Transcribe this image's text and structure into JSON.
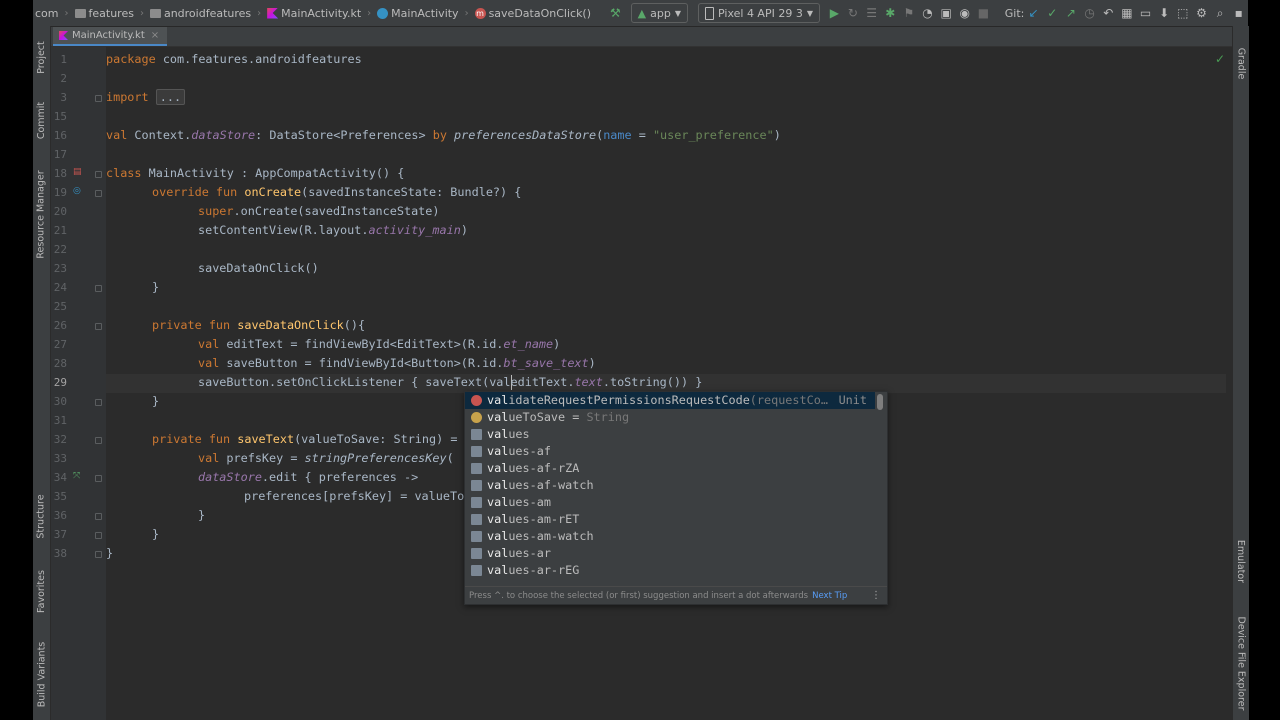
{
  "toolbar": {
    "breadcrumbs": [
      "com",
      "features",
      "androidfeatures",
      "MainActivity.kt",
      "MainActivity",
      "saveDataOnClick()"
    ],
    "run_config": "app",
    "device": "Pixel 4 API 29 3",
    "git_label": "Git:"
  },
  "tab": {
    "label": "MainActivity.kt",
    "close": "×"
  },
  "left_tool_windows": [
    "Project",
    "Commit",
    "Resource Manager",
    "Structure",
    "Favorites",
    "Build Variants"
  ],
  "right_tool_windows": [
    "Gradle",
    "Emulator",
    "Device File Explorer"
  ],
  "line_numbers": [
    "1",
    "2",
    "3",
    "15",
    "16",
    "17",
    "18",
    "19",
    "20",
    "21",
    "22",
    "23",
    "24",
    "25",
    "26",
    "27",
    "28",
    "29",
    "30",
    "31",
    "32",
    "33",
    "34",
    "35",
    "36",
    "37",
    "38"
  ],
  "current_line": "29",
  "code": {
    "l1": {
      "kw": "package",
      "rest": " com.features.androidfeatures"
    },
    "l3": {
      "kw": "import",
      "rest": " ",
      "folded": "..."
    },
    "l16": {
      "kw": "val",
      "a": " Context.",
      "b": "dataStore",
      "c": ": DataStore<Preferences> ",
      "kw2": "by",
      "d": " ",
      "e": "preferencesDataStore",
      "f": "(",
      "g": "name",
      "h": " = ",
      "i": "\"user_preference\"",
      "j": ")"
    },
    "l18": {
      "kw": "class",
      "rest": " MainActivity : AppCompatActivity() {"
    },
    "l19": {
      "kw": "override fun",
      "fn": " onCreate",
      "rest": "(savedInstanceState: Bundle?) {"
    },
    "l20": {
      "kw": "super",
      "rest": ".onCreate(savedInstanceState)"
    },
    "l21": {
      "a": "setContentView(R.layout.",
      "b": "activity_main",
      "c": ")"
    },
    "l23": {
      "a": "saveDataOnClick()"
    },
    "l24": {
      "a": "}"
    },
    "l26": {
      "kw": "private fun",
      "fn": " saveDataOnClick",
      "rest": "(){"
    },
    "l27": {
      "kw": "val",
      "a": " editText = findViewById<EditText>(R.id.",
      "b": "et_name",
      "c": ")"
    },
    "l28": {
      "kw": "val",
      "a": " saveButton = findViewById<Button>(R.id.",
      "b": "bt_save_text",
      "c": ")"
    },
    "l29": {
      "a": "saveButton.setOnClickListener { saveText(val",
      "b": "editText.",
      "c": "text",
      ".d": "",
      "d": ".toString()) }"
    },
    "l30": {
      "a": "}"
    },
    "l32": {
      "kw": "private fun",
      "fn": " saveText",
      "rest": "(valueToSave: String) = "
    },
    "l33": {
      "kw": "val",
      "a": " prefsKey = ",
      "b": "stringPreferencesKey",
      "c": "("
    },
    "l34": {
      "b": "dataStore",
      "a": ".edit { preferences ->"
    },
    "l35": {
      "a": "preferences[prefsKey] = valueTo"
    },
    "l36": {
      "a": "}"
    },
    "l37": {
      "a": "}"
    },
    "l38": {
      "a": "}"
    }
  },
  "completion": {
    "items": [
      {
        "match": "val",
        "rest": "idateRequestPermissionsRequestCode",
        "tail": "(requestCo…",
        "type": "Unit",
        "icon": "method-icon"
      },
      {
        "match": "val",
        "rest": "ueToSave",
        "tail": " = ",
        "type": "String",
        "icon": "parameter-icon"
      },
      {
        "match": "val",
        "rest": "ues",
        "tail": "",
        "type": "",
        "icon": "folder-icon"
      },
      {
        "match": "val",
        "rest": "ues-af",
        "tail": "",
        "type": "",
        "icon": "folder-icon"
      },
      {
        "match": "val",
        "rest": "ues-af-rZA",
        "tail": "",
        "type": "",
        "icon": "folder-icon"
      },
      {
        "match": "val",
        "rest": "ues-af-watch",
        "tail": "",
        "type": "",
        "icon": "folder-icon"
      },
      {
        "match": "val",
        "rest": "ues-am",
        "tail": "",
        "type": "",
        "icon": "folder-icon"
      },
      {
        "match": "val",
        "rest": "ues-am-rET",
        "tail": "",
        "type": "",
        "icon": "folder-icon"
      },
      {
        "match": "val",
        "rest": "ues-am-watch",
        "tail": "",
        "type": "",
        "icon": "folder-icon"
      },
      {
        "match": "val",
        "rest": "ues-ar",
        "tail": "",
        "type": "",
        "icon": "folder-icon"
      },
      {
        "match": "val",
        "rest": "ues-ar-rEG",
        "tail": "",
        "type": "",
        "icon": "folder-icon"
      }
    ],
    "footer": "Press ^. to choose the selected (or first) suggestion and insert a dot afterwards",
    "next_tip": "Next Tip",
    "more": "⋮"
  }
}
